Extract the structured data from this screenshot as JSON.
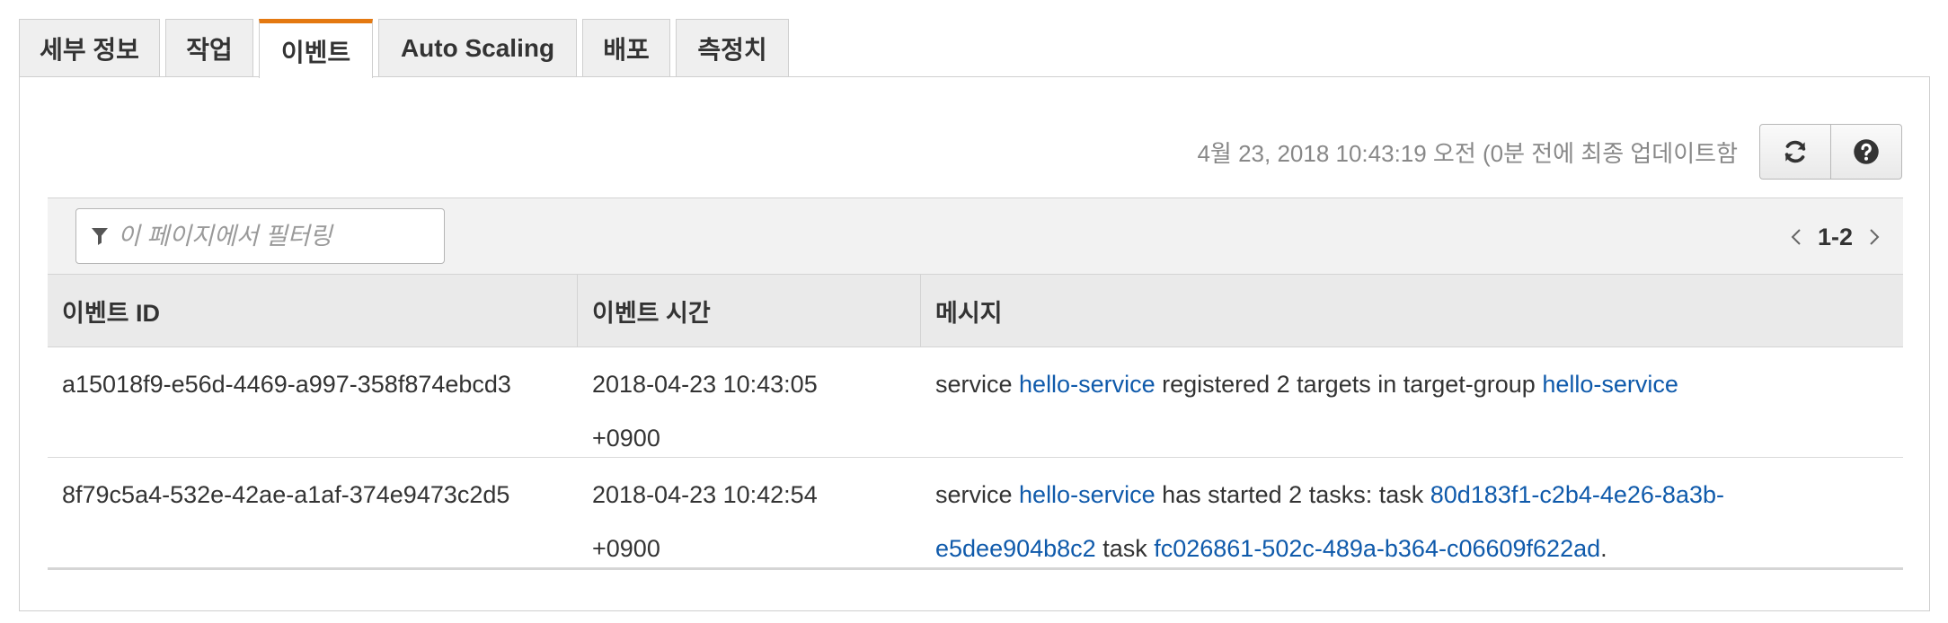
{
  "tabs": [
    {
      "label": "세부 정보",
      "width": 157
    },
    {
      "label": "작업",
      "width": 98
    },
    {
      "label": "이벤트",
      "width": 127,
      "active": true
    },
    {
      "label": "Auto Scaling",
      "width": 221
    },
    {
      "label": "배포",
      "width": 98
    },
    {
      "label": "측정치",
      "width": 126
    }
  ],
  "toolbar": {
    "timestamp": "4월 23, 2018 10:43:19 오전 (0분 전에 최종 업데이트함",
    "refresh_icon": "refresh-icon",
    "help_icon": "help-icon"
  },
  "filter": {
    "placeholder": "이 페이지에서 필터링",
    "icon": "filter-icon"
  },
  "pagination": {
    "range": "1-2"
  },
  "table": {
    "headers": [
      "이벤트 ID",
      "이벤트 시간",
      "메시지"
    ],
    "rows": [
      {
        "id": "a15018f9-e56d-4469-a997-358f874ebcd3",
        "time_line1": "2018-04-23 10:43:05",
        "time_line2": "+0900",
        "message": [
          {
            "text": "service ",
            "link": false
          },
          {
            "text": "hello-service",
            "link": true
          },
          {
            "text": " registered 2 targets in target-group ",
            "link": false
          },
          {
            "text": "hello-service",
            "link": true
          }
        ]
      },
      {
        "id": "8f79c5a4-532e-42ae-a1af-374e9473c2d5",
        "time_line1": "2018-04-23 10:42:54",
        "time_line2": "+0900",
        "message": [
          {
            "text": "service ",
            "link": false
          },
          {
            "text": "hello-service",
            "link": true
          },
          {
            "text": " has started 2 tasks: task ",
            "link": false
          },
          {
            "text": "80d183f1-c2b4-4e26-8a3b-e5dee904b8c2",
            "link": true
          },
          {
            "text": " task ",
            "link": false
          },
          {
            "text": "fc026861-502c-489a-b364-c06609f622ad",
            "link": true
          },
          {
            "text": ".",
            "link": false
          }
        ]
      }
    ]
  },
  "colors": {
    "accent": "#e47911",
    "link": "#0f5aab"
  }
}
